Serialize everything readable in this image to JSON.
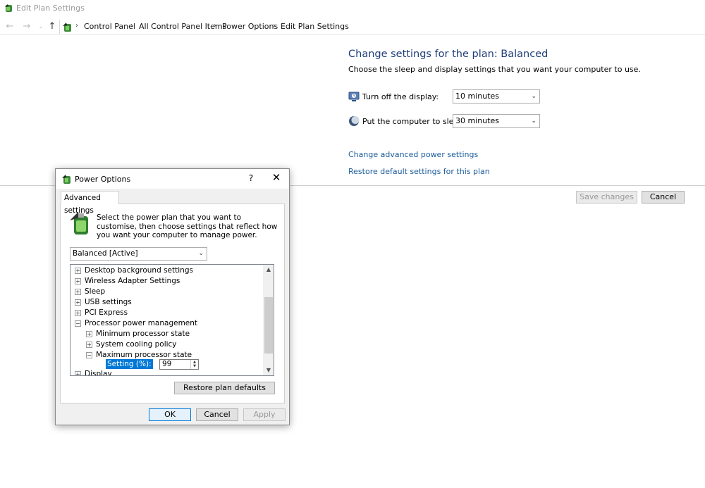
{
  "window": {
    "title": "Edit Plan Settings"
  },
  "breadcrumb": [
    "Control Panel",
    "All Control Panel Items",
    "Power Options",
    "Edit Plan Settings"
  ],
  "plan": {
    "heading": "Change settings for the plan: Balanced",
    "subheading": "Choose the sleep and display settings that you want your computer to use.",
    "display_label": "Turn off the display:",
    "display_value": "10 minutes",
    "sleep_label": "Put the computer to sleep:",
    "sleep_value": "30 minutes",
    "advanced_link": "Change advanced power settings",
    "restore_link": "Restore default settings for this plan",
    "save_label": "Save changes",
    "cancel_label": "Cancel"
  },
  "dialog": {
    "title": "Power Options",
    "help": "?",
    "tab": "Advanced settings",
    "intro": "Select the power plan that you want to customise, then choose settings that reflect how you want your computer to manage power.",
    "plan_select": "Balanced [Active]",
    "tree": [
      {
        "label": "Desktop background settings",
        "expanded": false
      },
      {
        "label": "Wireless Adapter Settings",
        "expanded": false
      },
      {
        "label": "Sleep",
        "expanded": false
      },
      {
        "label": "USB settings",
        "expanded": false
      },
      {
        "label": "PCI Express",
        "expanded": false
      },
      {
        "label": "Processor power management",
        "expanded": true
      },
      {
        "label": "Minimum processor state",
        "expanded": false
      },
      {
        "label": "System cooling policy",
        "expanded": false
      },
      {
        "label": "Maximum processor state",
        "expanded": true
      },
      {
        "label": "Display",
        "expanded": false
      }
    ],
    "setting_label": "Setting (%):",
    "setting_value": "99",
    "restore_defaults": "Restore plan defaults",
    "ok": "OK",
    "cancel": "Cancel",
    "apply": "Apply"
  },
  "colors": {
    "heading": "#1e3d79",
    "link": "#1a5b9a",
    "selection": "#0078d7"
  },
  "icons": [
    "power-plan-icon",
    "back-arrow-icon",
    "forward-arrow-icon",
    "up-arrow-icon",
    "chevron-right-icon",
    "monitor-icon",
    "moon-icon",
    "chevron-down-icon",
    "help-icon",
    "close-icon",
    "expand-plus-icon",
    "collapse-minus-icon",
    "scroll-up-icon",
    "scroll-down-icon"
  ]
}
